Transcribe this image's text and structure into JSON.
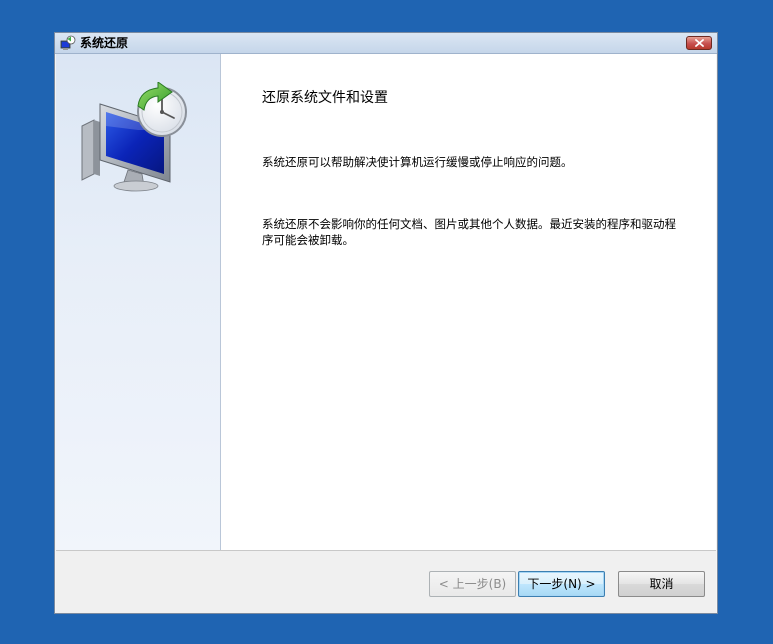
{
  "window": {
    "title": "系统还原"
  },
  "page": {
    "heading": "还原系统文件和设置",
    "paragraph1": "系统还原可以帮助解决使计算机运行缓慢或停止响应的问题。",
    "paragraph2": "系统还原不会影响你的任何文档、图片或其他个人数据。最近安装的程序和驱动程序可能会被卸载。"
  },
  "buttons": {
    "back": "< 上一步(B)",
    "next": "下一步(N) >",
    "cancel": "取消"
  },
  "icons": {
    "title": "system-restore-icon",
    "hero": "system-restore-computer-clock-icon",
    "close": "close-icon"
  },
  "colors": {
    "desktop": "#1f64b2",
    "sidebar": "#dbe6f4",
    "close_button": "#c75050",
    "default_button_border": "#3c7fb1"
  }
}
